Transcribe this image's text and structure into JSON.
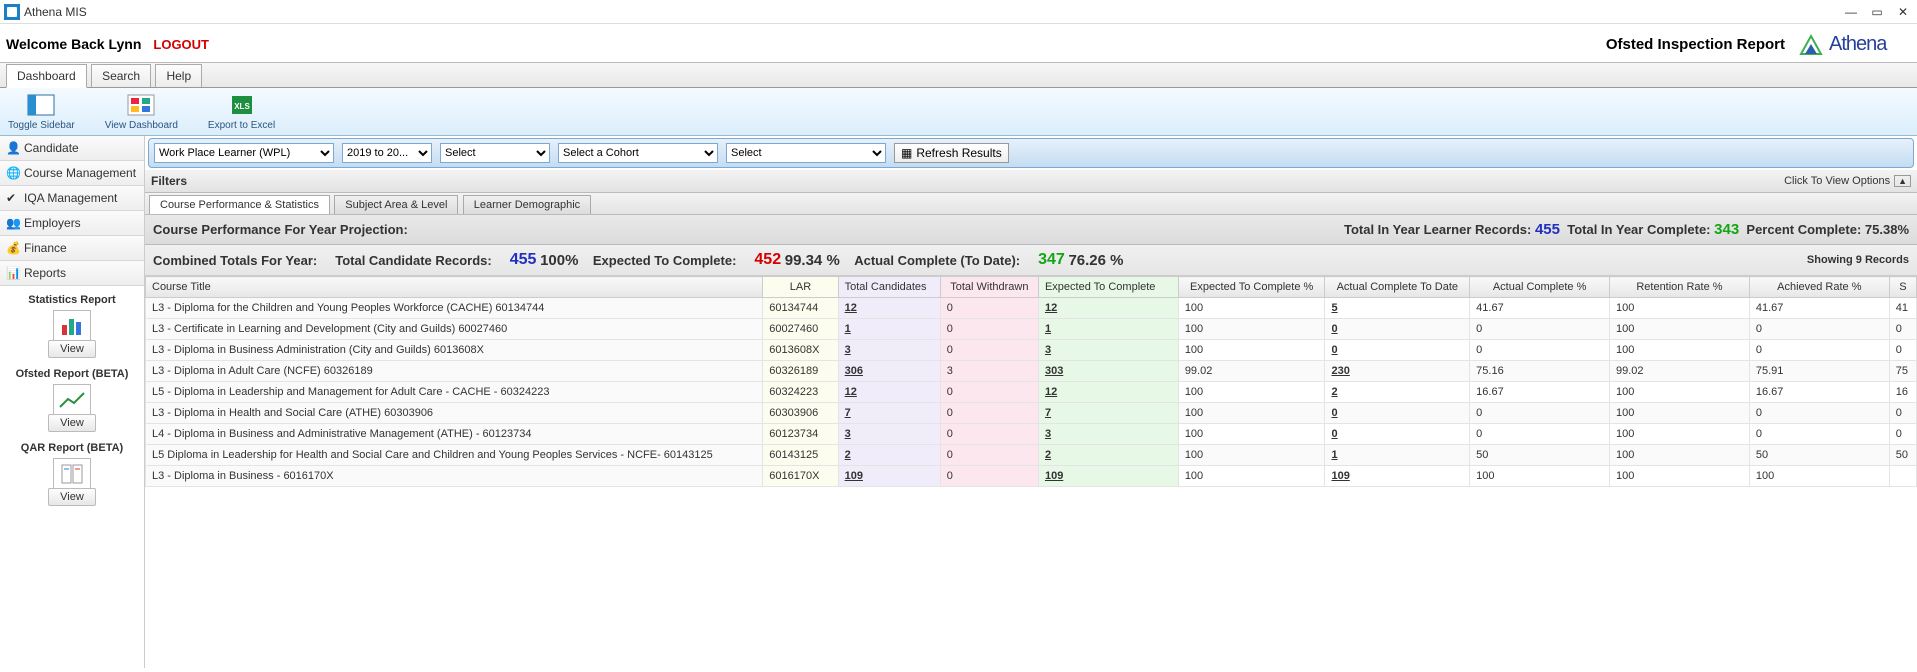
{
  "window": {
    "title": "Athena MIS"
  },
  "header": {
    "welcome": "Welcome Back Lynn",
    "logout": "LOGOUT",
    "report_title": "Ofsted Inspection Report",
    "logo_text": "Athena"
  },
  "tabs": {
    "dashboard": "Dashboard",
    "search": "Search",
    "help": "Help"
  },
  "ribbon": {
    "toggle_sidebar": "Toggle Sidebar",
    "view_dashboard": "View Dashboard",
    "export_excel": "Export to Excel"
  },
  "sidebar": {
    "candidate": "Candidate",
    "course_mgmt": "Course Management",
    "iqa_mgmt": "IQA Management",
    "employers": "Employers",
    "finance": "Finance",
    "reports": "Reports",
    "stats_title": "Statistics Report",
    "ofsted_title": "Ofsted Report (BETA)",
    "qar_title": "QAR Report (BETA)",
    "view": "View"
  },
  "filters": {
    "wpl": "Work Place Learner (WPL)",
    "year": "2019 to 20...",
    "select1": "Select",
    "cohort": "Select a Cohort",
    "select2": "Select",
    "refresh": "Refresh Results",
    "label": "Filters",
    "click_opts": "Click To View Options"
  },
  "subtabs": {
    "cps": "Course Performance & Statistics",
    "sal": "Subject Area & Level",
    "ld": "Learner Demographic"
  },
  "proj": {
    "label": "Course Performance For Year Projection:",
    "rec_label": "Total In Year Learner Records:",
    "rec_val": "455",
    "comp_label": "Total In Year Complete:",
    "comp_val": "343",
    "pct_label": "Percent Complete:",
    "pct_val": "75.38%"
  },
  "combined": {
    "label": "Combined Totals For Year:",
    "tcr_label": "Total Candidate Records:",
    "tcr_val": "455",
    "tcr_pct": "100%",
    "etc_label": "Expected To Complete:",
    "etc_val": "452",
    "etc_pct": "99.34 %",
    "act_label": "Actual Complete (To Date):",
    "act_val": "347",
    "act_pct": "76.26 %",
    "showing": "Showing 9 Records"
  },
  "table": {
    "headers": {
      "title": "Course Title",
      "lar": "LAR",
      "tc": "Total Candidates",
      "tw": "Total Withdrawn",
      "etc": "Expected To Complete",
      "etcp": "Expected To Complete %",
      "actd": "Actual Complete To Date",
      "actp": "Actual Complete %",
      "ret": "Retention Rate %",
      "ach": "Achieved Rate %",
      "s": "S"
    },
    "rows": [
      {
        "title": "L3 - Diploma for the Children and Young Peoples Workforce (CACHE) 60134744",
        "lar": "60134744",
        "tc": "12",
        "tw": "0",
        "etc": "12",
        "etcp": "100",
        "actd": "5",
        "actp": "41.67",
        "ret": "100",
        "ach": "41.67",
        "s": "41"
      },
      {
        "title": "L3 - Certificate in Learning and Development (City and Guilds) 60027460",
        "lar": "60027460",
        "tc": "1",
        "tw": "0",
        "etc": "1",
        "etcp": "100",
        "actd": "0",
        "actp": "0",
        "ret": "100",
        "ach": "0",
        "s": "0"
      },
      {
        "title": "L3 - Diploma in Business Administration (City and Guilds) 6013608X",
        "lar": "6013608X",
        "tc": "3",
        "tw": "0",
        "etc": "3",
        "etcp": "100",
        "actd": "0",
        "actp": "0",
        "ret": "100",
        "ach": "0",
        "s": "0"
      },
      {
        "title": "L3 - Diploma in Adult Care (NCFE) 60326189",
        "lar": "60326189",
        "tc": "306",
        "tw": "3",
        "etc": "303",
        "etcp": "99.02",
        "actd": "230",
        "actp": "75.16",
        "ret": "99.02",
        "ach": "75.91",
        "s": "75"
      },
      {
        "title": "L5 - Diploma in Leadership and Management for Adult Care - CACHE - 60324223",
        "lar": "60324223",
        "tc": "12",
        "tw": "0",
        "etc": "12",
        "etcp": "100",
        "actd": "2",
        "actp": "16.67",
        "ret": "100",
        "ach": "16.67",
        "s": "16"
      },
      {
        "title": "L3 - Diploma in Health and Social Care (ATHE) 60303906",
        "lar": "60303906",
        "tc": "7",
        "tw": "0",
        "etc": "7",
        "etcp": "100",
        "actd": "0",
        "actp": "0",
        "ret": "100",
        "ach": "0",
        "s": "0"
      },
      {
        "title": "L4 - Diploma in Business and Administrative Management (ATHE) - 60123734",
        "lar": "60123734",
        "tc": "3",
        "tw": "0",
        "etc": "3",
        "etcp": "100",
        "actd": "0",
        "actp": "0",
        "ret": "100",
        "ach": "0",
        "s": "0"
      },
      {
        "title": "L5 Diploma in Leadership for Health and Social Care and Children and Young Peoples Services - NCFE- 60143125",
        "lar": "60143125",
        "tc": "2",
        "tw": "0",
        "etc": "2",
        "etcp": "100",
        "actd": "1",
        "actp": "50",
        "ret": "100",
        "ach": "50",
        "s": "50"
      },
      {
        "title": "L3 - Diploma in Business - 6016170X",
        "lar": "6016170X",
        "tc": "109",
        "tw": "0",
        "etc": "109",
        "etcp": "100",
        "actd": "109",
        "actp": "100",
        "ret": "100",
        "ach": "100",
        "s": ""
      }
    ]
  }
}
